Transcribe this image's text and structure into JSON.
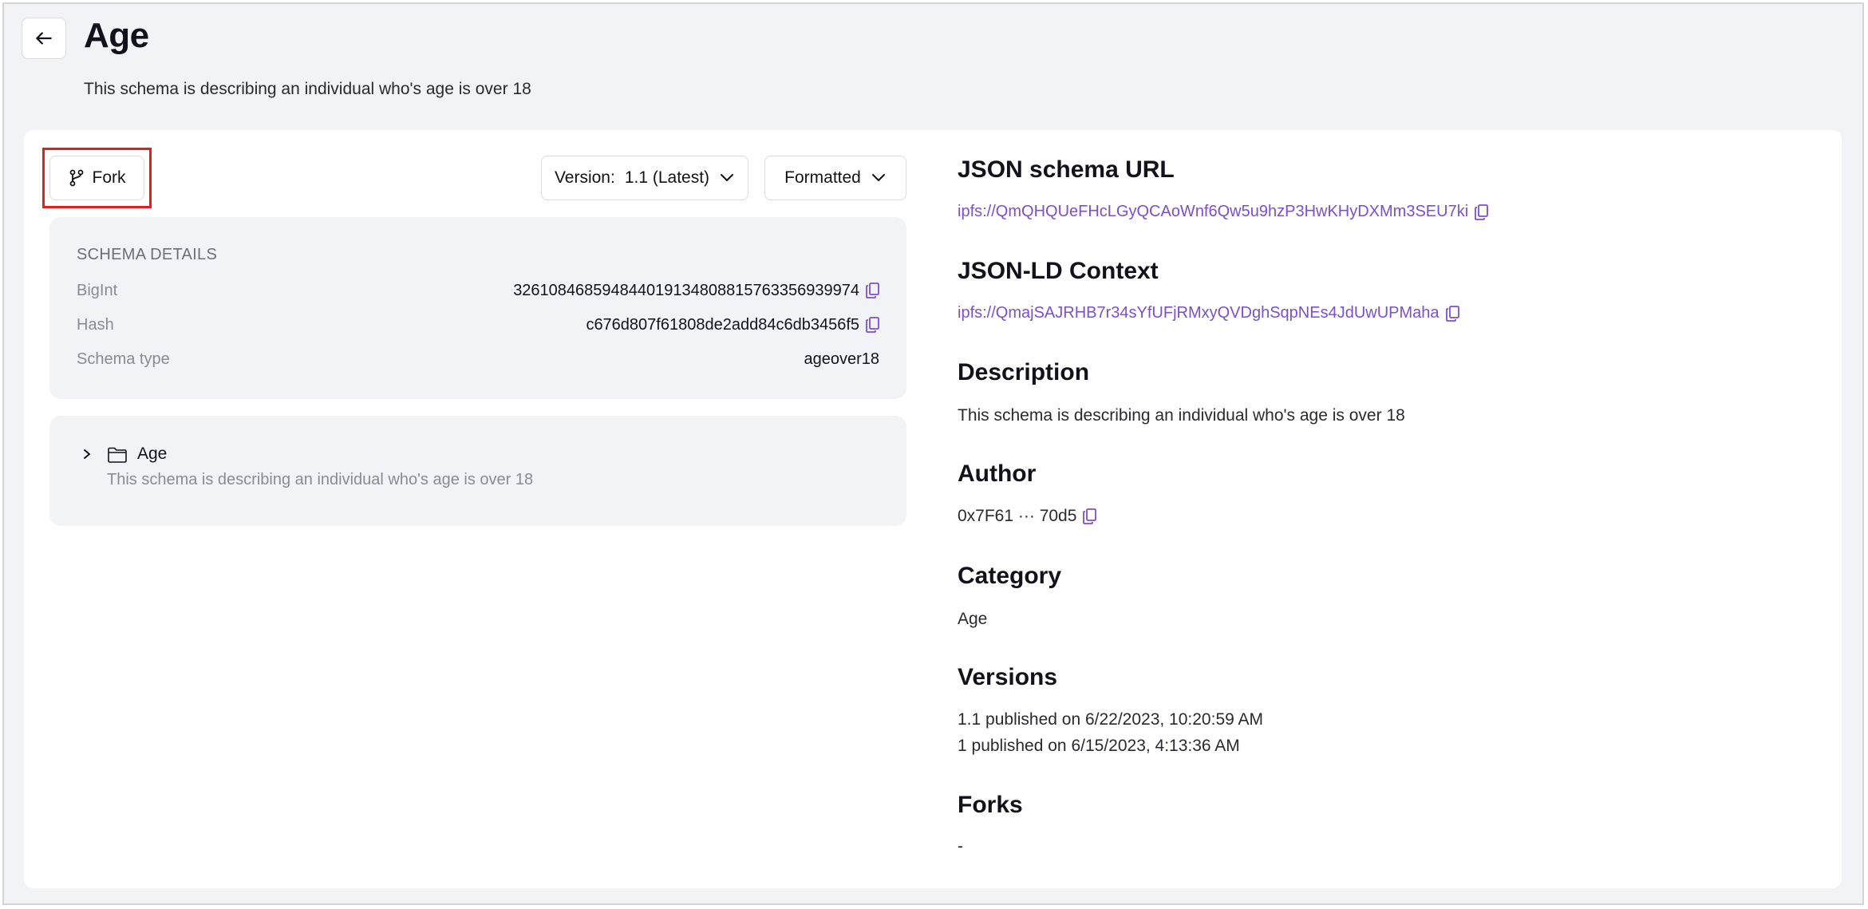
{
  "header": {
    "title": "Age",
    "subtitle": "This schema is describing an individual who's age is over 18"
  },
  "toolbar": {
    "fork_label": "Fork",
    "version_prefix": "Version:",
    "version_value": "1.1 (Latest)",
    "format_value": "Formatted"
  },
  "schema_details": {
    "title": "SCHEMA DETAILS",
    "rows": [
      {
        "label": "BigInt",
        "value": "326108468594844019134808815763356939974",
        "copyable": true
      },
      {
        "label": "Hash",
        "value": "c676d807f61808de2add84c6db3456f5",
        "copyable": true
      },
      {
        "label": "Schema type",
        "value": "ageover18",
        "copyable": false
      }
    ]
  },
  "tree": {
    "name": "Age",
    "description": "This schema is describing an individual who's age is over 18"
  },
  "sidebar": {
    "json_schema_url": {
      "heading": "JSON schema URL",
      "value": "ipfs://QmQHQUeFHcLGyQCAoWnf6Qw5u9hzP3HwKHyDXMm3SEU7ki"
    },
    "jsonld_context": {
      "heading": "JSON-LD Context",
      "value": "ipfs://QmajSAJRHB7r34sYfUFjRMxyQVDghSqpNEs4JdUwUPMaha"
    },
    "description": {
      "heading": "Description",
      "value": "This schema is describing an individual who's age is over 18"
    },
    "author": {
      "heading": "Author",
      "value": "0x7F61 ··· 70d5"
    },
    "category": {
      "heading": "Category",
      "value": "Age"
    },
    "versions": {
      "heading": "Versions",
      "items": [
        "1.1 published on 6/22/2023, 10:20:59 AM",
        "1 published on 6/15/2023, 4:13:36 AM"
      ]
    },
    "forks": {
      "heading": "Forks",
      "value": "-"
    }
  },
  "colors": {
    "accent": "#7b4fd0",
    "highlight": "#e0201b",
    "panel": "#f2f3f6"
  },
  "icons": [
    "arrow-left-icon",
    "git-fork-icon",
    "chevron-down-icon",
    "copy-icon",
    "chevron-right-icon",
    "folder-icon"
  ]
}
